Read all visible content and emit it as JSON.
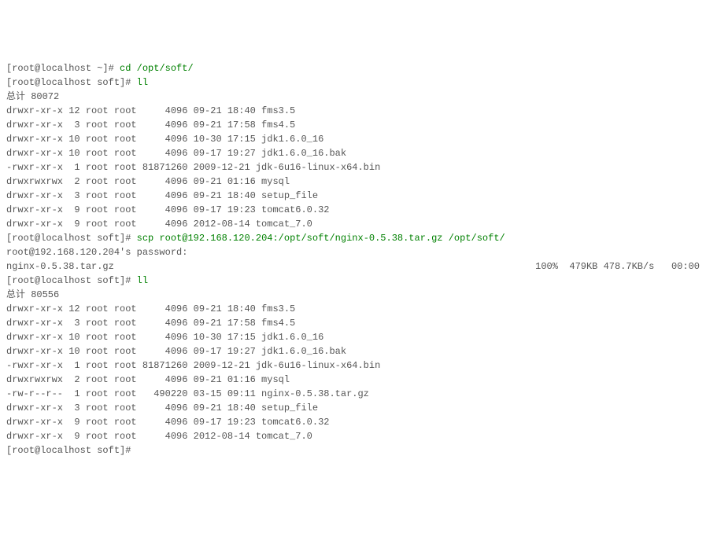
{
  "lines": [
    {
      "type": "prompt",
      "prompt": "[root@localhost ~]# ",
      "cmd": "cd /opt/soft/"
    },
    {
      "type": "prompt",
      "prompt": "[root@localhost soft]# ",
      "cmd": "ll"
    },
    {
      "type": "plain",
      "text": "总计 80072"
    },
    {
      "type": "plain",
      "text": "drwxr-xr-x 12 root root     4096 09-21 18:40 fms3.5"
    },
    {
      "type": "plain",
      "text": "drwxr-xr-x  3 root root     4096 09-21 17:58 fms4.5"
    },
    {
      "type": "plain",
      "text": "drwxr-xr-x 10 root root     4096 10-30 17:15 jdk1.6.0_16"
    },
    {
      "type": "plain",
      "text": "drwxr-xr-x 10 root root     4096 09-17 19:27 jdk1.6.0_16.bak"
    },
    {
      "type": "plain",
      "text": "-rwxr-xr-x  1 root root 81871260 2009-12-21 jdk-6u16-linux-x64.bin"
    },
    {
      "type": "plain",
      "text": "drwxrwxrwx  2 root root     4096 09-21 01:16 mysql"
    },
    {
      "type": "plain",
      "text": "drwxr-xr-x  3 root root     4096 09-21 18:40 setup_file"
    },
    {
      "type": "plain",
      "text": "drwxr-xr-x  9 root root     4096 09-17 19:23 tomcat6.0.32"
    },
    {
      "type": "plain",
      "text": "drwxr-xr-x  9 root root     4096 2012-08-14 tomcat_7.0"
    },
    {
      "type": "prompt",
      "prompt": "[root@localhost soft]# ",
      "cmd": "scp root@192.168.120.204:/opt/soft/nginx-0.5.38.tar.gz /opt/soft/"
    },
    {
      "type": "plain",
      "text": "root@192.168.120.204's password: "
    },
    {
      "type": "transfer",
      "file": "nginx-0.5.38.tar.gz",
      "stats": "100%  479KB 478.7KB/s   00:00"
    },
    {
      "type": "prompt",
      "prompt": "[root@localhost soft]# ",
      "cmd": "ll"
    },
    {
      "type": "plain",
      "text": "总计 80556"
    },
    {
      "type": "plain",
      "text": "drwxr-xr-x 12 root root     4096 09-21 18:40 fms3.5"
    },
    {
      "type": "plain",
      "text": "drwxr-xr-x  3 root root     4096 09-21 17:58 fms4.5"
    },
    {
      "type": "plain",
      "text": "drwxr-xr-x 10 root root     4096 10-30 17:15 jdk1.6.0_16"
    },
    {
      "type": "plain",
      "text": "drwxr-xr-x 10 root root     4096 09-17 19:27 jdk1.6.0_16.bak"
    },
    {
      "type": "plain",
      "text": "-rwxr-xr-x  1 root root 81871260 2009-12-21 jdk-6u16-linux-x64.bin"
    },
    {
      "type": "plain",
      "text": "drwxrwxrwx  2 root root     4096 09-21 01:16 mysql"
    },
    {
      "type": "plain",
      "text": "-rw-r--r--  1 root root   490220 03-15 09:11 nginx-0.5.38.tar.gz"
    },
    {
      "type": "plain",
      "text": "drwxr-xr-x  3 root root     4096 09-21 18:40 setup_file"
    },
    {
      "type": "plain",
      "text": "drwxr-xr-x  9 root root     4096 09-17 19:23 tomcat6.0.32"
    },
    {
      "type": "plain",
      "text": "drwxr-xr-x  9 root root     4096 2012-08-14 tomcat_7.0"
    },
    {
      "type": "prompt",
      "prompt": "[root@localhost soft]# ",
      "cmd": ""
    }
  ]
}
